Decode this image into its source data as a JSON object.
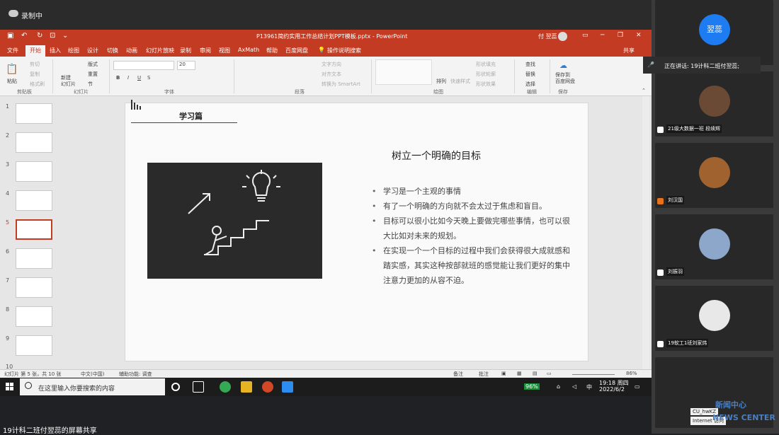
{
  "recording": {
    "label": "录制中"
  },
  "ppt": {
    "doc_title": "P13961简约实用工作总结计划PPT模板.pptx  -  PowerPoint",
    "user": "付 翌蕊",
    "tabs": [
      "文件",
      "开始",
      "插入",
      "绘图",
      "设计",
      "切换",
      "动画",
      "幻灯片放映",
      "录制",
      "审阅",
      "视图",
      "AxMath",
      "帮助",
      "百度网盘",
      "操作说明搜索"
    ],
    "share": "共享",
    "ribbon": {
      "paste": "粘贴",
      "cut": "剪切",
      "copy": "复制",
      "format_painter": "格式刷",
      "clipboard": "剪贴板",
      "new_slide": "新建\n幻灯片",
      "layout": "版式",
      "reset": "重置",
      "section": "节",
      "slides": "幻灯片",
      "font": "字体",
      "font_size": "20",
      "paragraph": "段落",
      "text_dir": "文字方向",
      "align_text": "对齐文本",
      "smartart": "转换为 SmartArt",
      "arrange": "排列",
      "quick_styles": "快速样式",
      "shape_fill": "形状填充",
      "shape_outline": "形状轮廓",
      "shape_effects": "形状效果",
      "drawing": "绘图",
      "find": "查找",
      "replace": "替换",
      "select": "选择",
      "editing": "编辑",
      "save_baidu": "保存到\n百度网盘",
      "save": "保存"
    },
    "thumbs": [
      "1",
      "2",
      "3",
      "4",
      "5",
      "6",
      "7",
      "8",
      "9",
      "10"
    ],
    "slide": {
      "header": "学习篇",
      "heading": "树立一个明确的目标",
      "bullets": [
        "学习是一个主观的事情",
        "有了一个明确的方向就不会太过于焦虑和盲目。",
        "目标可以很小比如今天晚上要做完哪些事情，也可以很大比如对未来的规划。",
        "在实现一个一个目标的过程中我们会获得很大成就感和踏实感，其实这种按部就班的感觉能让我们更好的集中注意力更加的从容不迫。"
      ]
    },
    "status": {
      "slide_num": "幻灯片 第 5 张，共 10 张",
      "lang": "中文(中国)",
      "accessibility": "辅助功能: 调查",
      "notes": "备注",
      "comments": "批注",
      "zoom": "86%"
    }
  },
  "taskbar": {
    "search_placeholder": "在这里输入你要搜索的内容",
    "battery": "96%",
    "ime": "中",
    "time": "19:18 周四",
    "date": "2022/6/2"
  },
  "share_label": "19计科二班付翌蕊的屏幕共享",
  "meeting": {
    "speaker": "正在讲话: 19计科二班付翌蕊;",
    "participants": [
      {
        "name": "翌蕊",
        "avatar_color": "#1e7cf2"
      },
      {
        "name": "21级大数据一班 段续辉",
        "avatar_color": "#6b4a35"
      },
      {
        "name": "刘汉国",
        "avatar_color": "#a0632f"
      },
      {
        "name": "刘振羽",
        "avatar_color": "#8ca7c9"
      },
      {
        "name": "19软工1班刘家炜",
        "avatar_color": "#e8e8e8"
      }
    ],
    "network": {
      "line1": "CU_hwKZ",
      "line2": "Internet 访问"
    }
  },
  "watermark": {
    "line1": "新闻中心",
    "line2": "NEWS CENTER"
  }
}
